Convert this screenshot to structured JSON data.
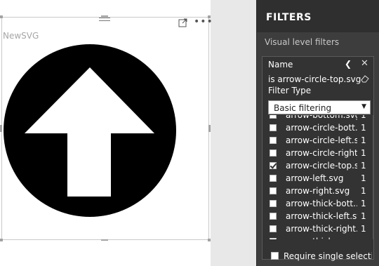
{
  "visual": {
    "title": "NewSVG",
    "icons": {
      "drag": "drag-grip-icon",
      "focus": "focus-mode-icon",
      "more": "more-options-icon"
    },
    "image_semantic": "arrow-circle-top"
  },
  "filters_pane": {
    "title": "FILTERS",
    "section": "Visual level filters",
    "card": {
      "field": "Name",
      "summary": "is arrow-circle-top.svg",
      "filter_type_label": "Filter Type",
      "filter_type_value": "Basic filtering",
      "items": [
        {
          "label": "arrow-bottom.svg",
          "count": "1",
          "checked": false
        },
        {
          "label": "arrow-circle-bott...",
          "count": "1",
          "checked": false
        },
        {
          "label": "arrow-circle-left.s...",
          "count": "1",
          "checked": false
        },
        {
          "label": "arrow-circle-right...",
          "count": "1",
          "checked": false
        },
        {
          "label": "arrow-circle-top.s...",
          "count": "1",
          "checked": true
        },
        {
          "label": "arrow-left.svg",
          "count": "1",
          "checked": false
        },
        {
          "label": "arrow-right.svg",
          "count": "1",
          "checked": false
        },
        {
          "label": "arrow-thick-bott...",
          "count": "1",
          "checked": false
        },
        {
          "label": "arrow-thick-left.svg",
          "count": "1",
          "checked": false
        },
        {
          "label": "arrow-thick-right...",
          "count": "1",
          "checked": false
        },
        {
          "label": "arrow-thick-...",
          "count": "",
          "checked": false
        }
      ],
      "require_single": "Require single selecti..."
    }
  },
  "colors": {
    "pane_bg": "#3d3d3d",
    "pane_header_bg": "#2f2f2f",
    "canvas_bg": "#ffffff",
    "arrow_circle": "#000000"
  }
}
